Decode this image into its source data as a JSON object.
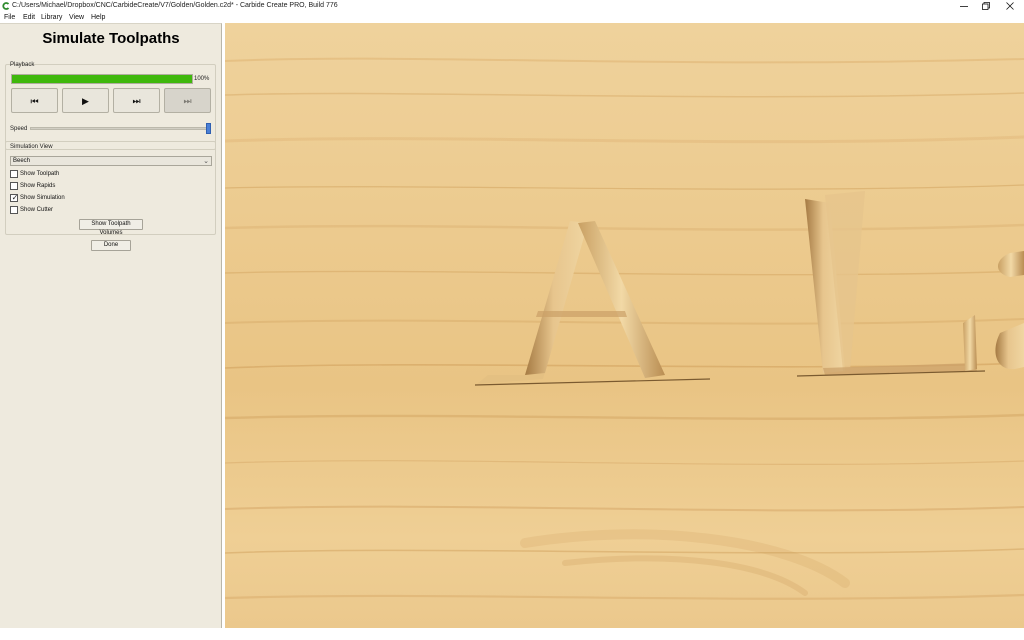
{
  "window": {
    "title": "C:/Users/Michael/Dropbox/CNC/CarbideCreate/V7/Golden/Golden.c2d* - Carbide Create PRO, Build 776",
    "app_icon": "carbide-c-icon",
    "controls": [
      "minimize-icon",
      "maximize-icon",
      "close-icon"
    ]
  },
  "menu": {
    "items": [
      {
        "label": "File"
      },
      {
        "label": "Edit"
      },
      {
        "label": "Library"
      },
      {
        "label": "View"
      },
      {
        "label": "Help"
      }
    ]
  },
  "sidebar": {
    "title": "Simulate Toolpaths",
    "playback": {
      "label": "Playback",
      "progress": 1.0,
      "progress_text": "100%",
      "buttons": [
        {
          "name": "rewind",
          "icon": "skip-to-start-icon",
          "glyph": "⏮",
          "enabled": true
        },
        {
          "name": "play",
          "icon": "play-icon",
          "glyph": "▶",
          "enabled": true
        },
        {
          "name": "step",
          "icon": "step-forward-icon",
          "glyph": "⏭",
          "enabled": true
        },
        {
          "name": "end",
          "icon": "skip-to-end-icon",
          "glyph": "⏭",
          "enabled": false
        }
      ],
      "speed_label": "Speed",
      "speed": 1.0
    },
    "simulation_view": {
      "label": "Simulation View",
      "material": "Beech",
      "options": [
        {
          "label": "Show Toolpath",
          "checked": false
        },
        {
          "label": "Show Rapids",
          "checked": false
        },
        {
          "label": "Show Simulation",
          "checked": true
        },
        {
          "label": "Show Cutter",
          "checked": false
        }
      ],
      "volumes_button": "Show Toolpath Volumes"
    },
    "done_button": "Done"
  },
  "colors": {
    "progress": "#3fb80c",
    "slider_handle": "#4a7fd6",
    "wood_light": "#efd09a",
    "wood_mid": "#e3b978",
    "wood_dark": "#c99555"
  }
}
